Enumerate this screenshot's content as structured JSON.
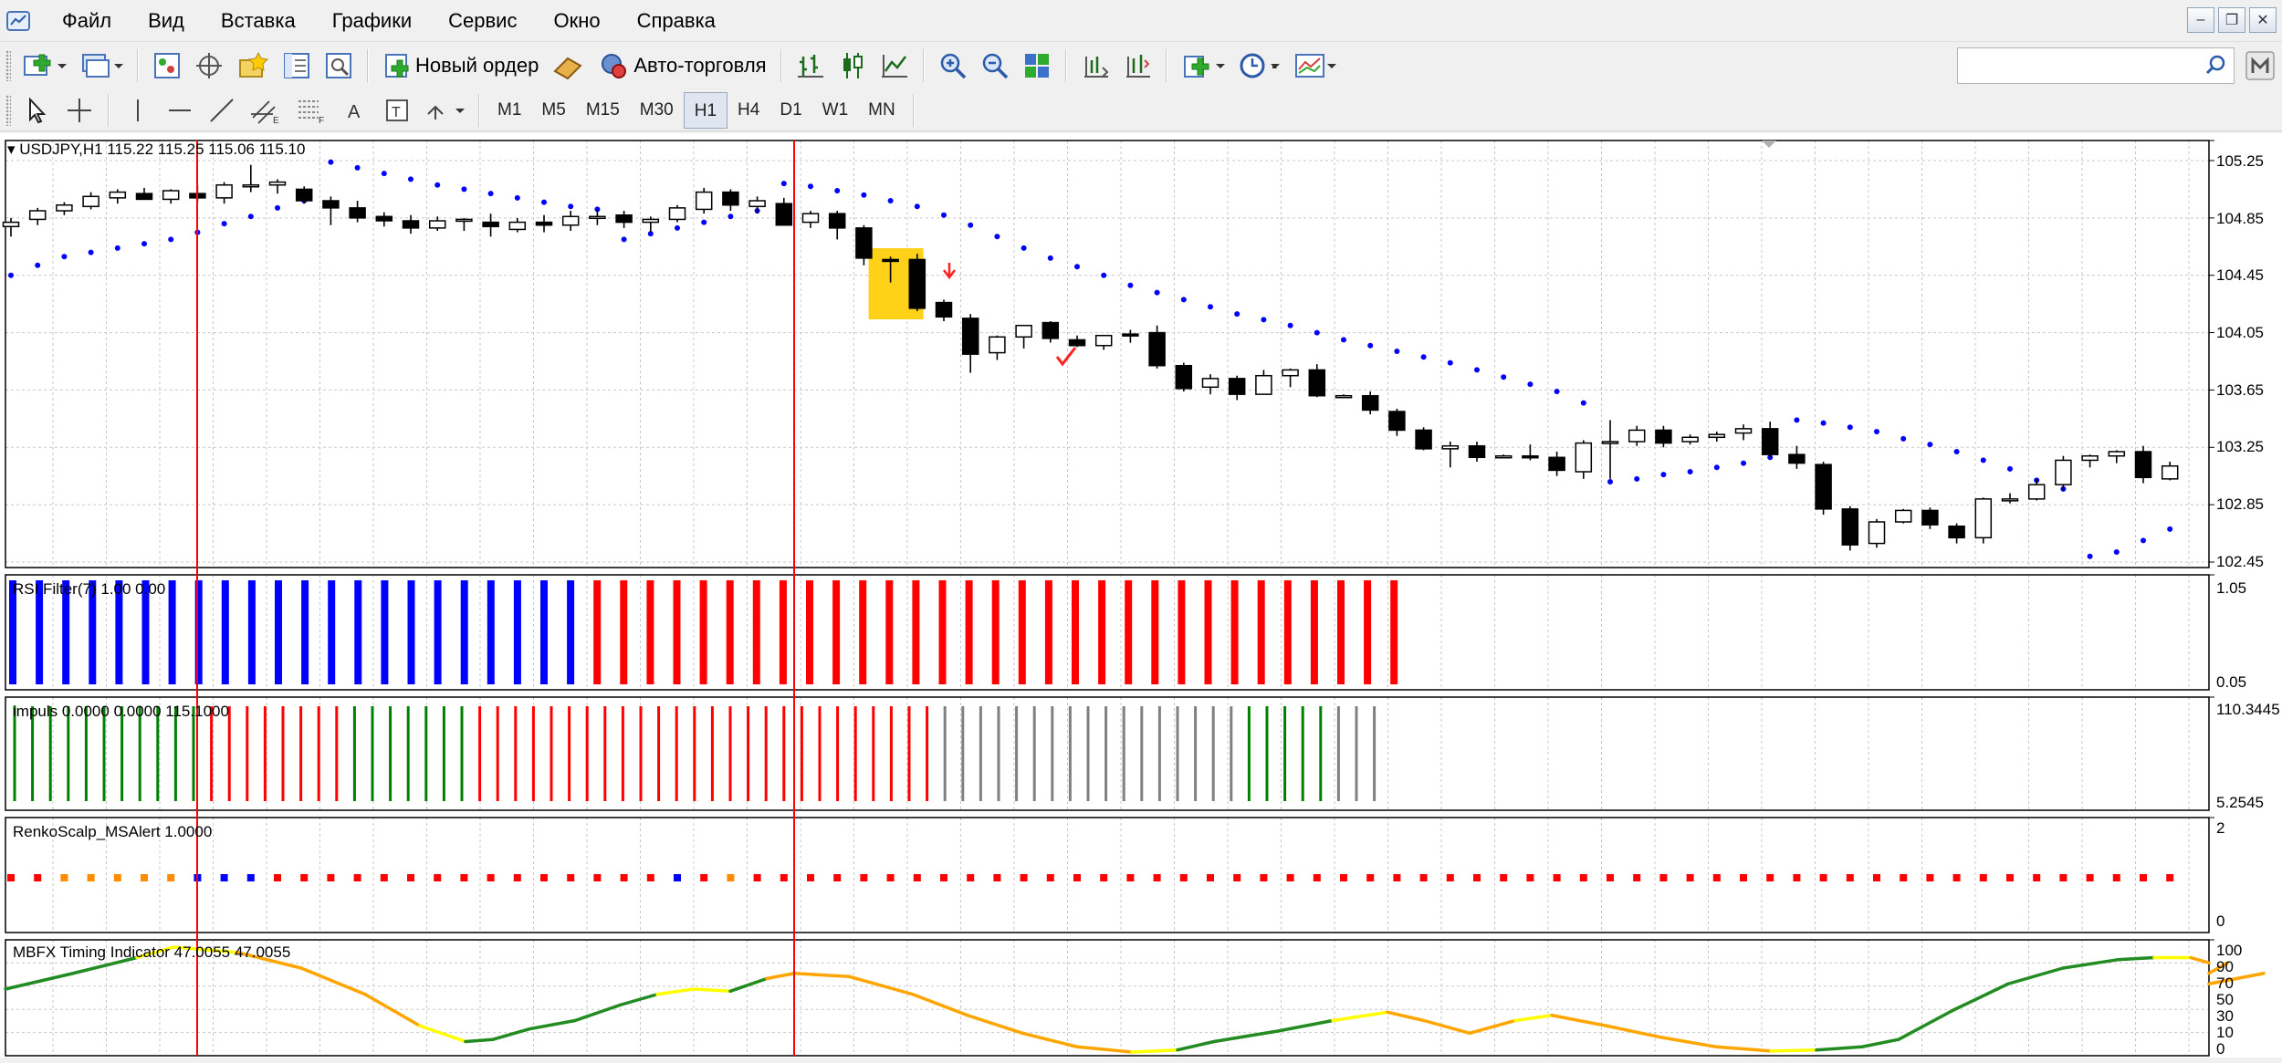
{
  "menu": {
    "items": [
      "Файл",
      "Вид",
      "Вставка",
      "Графики",
      "Сервис",
      "Окно",
      "Справка"
    ]
  },
  "toolbar": {
    "new_order_label": "Новый ордер",
    "auto_trading_label": "Авто-торговля",
    "timeframes": [
      "M1",
      "M5",
      "M15",
      "M30",
      "H1",
      "H4",
      "D1",
      "W1",
      "MN"
    ],
    "active_timeframe": "H1",
    "search_value": ""
  },
  "colors": {
    "bull": "#ffffff",
    "bear": "#000000",
    "sar": "#0000ff",
    "vline": "#ff0000",
    "rsi_up": "#0000ff",
    "rsi_down": "#ff0000",
    "impuls_up": "#008000",
    "impuls_down": "#ff0000",
    "impuls_flat": "#808080",
    "highlight": "#ffcc00",
    "mbfx_green": "#228b22",
    "mbfx_yellow": "#ffff00",
    "mbfx_orange": "#ffa500"
  },
  "chart": {
    "main_label": "USDJPY,H1  115.22 115.25 115.06 115.10",
    "price_ticks": [
      "105.25",
      "104.85",
      "104.45",
      "104.05",
      "103.65",
      "103.25",
      "102.85",
      "102.45"
    ],
    "rsi_label": "RSI Filter(7) 1.00 0.00",
    "rsi_axis": [
      "1.05",
      "0.05"
    ],
    "impuls_label": "impuls 0.0000 0.0000 115.1000",
    "impuls_axis": [
      "110.3445",
      "5.2545"
    ],
    "renko_label": "RenkoScalp_MSAlert 1.0000",
    "renko_axis": [
      "2",
      "0"
    ],
    "mbfx_label": "MBFX Timing Indicator 47.0055 47.0055",
    "mbfx_axis": [
      "100",
      "90",
      "70",
      "50",
      "30",
      "10",
      "0"
    ]
  },
  "chart_data": {
    "type": "candlestick",
    "symbol": "USDJPY",
    "timeframe": "H1",
    "ylim": [
      102.4,
      105.35
    ],
    "candles": [
      [
        104.79,
        104.85,
        104.72,
        104.82
      ],
      [
        104.84,
        104.92,
        104.8,
        104.9
      ],
      [
        104.9,
        104.96,
        104.87,
        104.94
      ],
      [
        104.93,
        105.03,
        104.91,
        105.0
      ],
      [
        104.99,
        105.05,
        104.95,
        105.03
      ],
      [
        105.02,
        105.06,
        104.98,
        104.98
      ],
      [
        104.98,
        105.05,
        104.95,
        105.04
      ],
      [
        105.02,
        105.08,
        104.96,
        104.99
      ],
      [
        104.99,
        105.1,
        104.95,
        105.08
      ],
      [
        105.08,
        105.22,
        105.03,
        105.08
      ],
      [
        105.08,
        105.12,
        105.02,
        105.1
      ],
      [
        105.05,
        105.07,
        104.95,
        104.97
      ],
      [
        104.97,
        105.0,
        104.8,
        104.92
      ],
      [
        104.92,
        104.97,
        104.82,
        104.85
      ],
      [
        104.86,
        104.89,
        104.79,
        104.83
      ],
      [
        104.83,
        104.87,
        104.74,
        104.78
      ],
      [
        104.78,
        104.86,
        104.76,
        104.83
      ],
      [
        104.83,
        104.85,
        104.76,
        104.84
      ],
      [
        104.82,
        104.88,
        104.72,
        104.79
      ],
      [
        104.77,
        104.85,
        104.75,
        104.82
      ],
      [
        104.82,
        104.87,
        104.75,
        104.8
      ],
      [
        104.8,
        104.9,
        104.76,
        104.86
      ],
      [
        104.85,
        104.91,
        104.8,
        104.86
      ],
      [
        104.87,
        104.9,
        104.78,
        104.82
      ],
      [
        104.82,
        104.86,
        104.75,
        104.84
      ],
      [
        104.84,
        104.94,
        104.82,
        104.92
      ],
      [
        104.91,
        105.06,
        104.88,
        105.03
      ],
      [
        105.03,
        105.05,
        104.9,
        104.94
      ],
      [
        104.93,
        105.0,
        104.88,
        104.97
      ],
      [
        104.95,
        104.99,
        104.8,
        104.8
      ],
      [
        104.82,
        104.9,
        104.78,
        104.88
      ],
      [
        104.88,
        104.9,
        104.7,
        104.78
      ],
      [
        104.78,
        104.8,
        104.52,
        104.57
      ],
      [
        104.56,
        104.58,
        104.4,
        104.55
      ],
      [
        104.56,
        104.6,
        104.2,
        104.22
      ],
      [
        104.26,
        104.28,
        104.13,
        104.16
      ],
      [
        104.15,
        104.18,
        103.77,
        103.9
      ],
      [
        103.91,
        104.03,
        103.86,
        104.02
      ],
      [
        104.02,
        104.1,
        103.94,
        104.1
      ],
      [
        104.12,
        104.13,
        103.98,
        104.01
      ],
      [
        104.0,
        104.03,
        103.95,
        103.96
      ],
      [
        103.96,
        104.03,
        103.93,
        104.03
      ],
      [
        104.04,
        104.07,
        103.98,
        104.03
      ],
      [
        104.05,
        104.1,
        103.8,
        103.82
      ],
      [
        103.82,
        103.84,
        103.64,
        103.66
      ],
      [
        103.67,
        103.76,
        103.62,
        103.73
      ],
      [
        103.73,
        103.75,
        103.58,
        103.62
      ],
      [
        103.62,
        103.79,
        103.62,
        103.75
      ],
      [
        103.75,
        103.8,
        103.67,
        103.79
      ],
      [
        103.79,
        103.83,
        103.6,
        103.61
      ],
      [
        103.61,
        103.62,
        103.6,
        103.61
      ],
      [
        103.61,
        103.64,
        103.48,
        103.51
      ],
      [
        103.5,
        103.52,
        103.33,
        103.37
      ],
      [
        103.37,
        103.39,
        103.23,
        103.24
      ],
      [
        103.24,
        103.29,
        103.11,
        103.26
      ],
      [
        103.26,
        103.29,
        103.15,
        103.18
      ],
      [
        103.19,
        103.2,
        103.18,
        103.19
      ],
      [
        103.19,
        103.27,
        103.16,
        103.18
      ],
      [
        103.18,
        103.22,
        103.05,
        103.09
      ],
      [
        103.08,
        103.3,
        103.03,
        103.28
      ],
      [
        103.28,
        103.44,
        103.03,
        103.29
      ],
      [
        103.29,
        103.4,
        103.26,
        103.37
      ],
      [
        103.37,
        103.4,
        103.25,
        103.28
      ],
      [
        103.29,
        103.34,
        103.27,
        103.32
      ],
      [
        103.32,
        103.36,
        103.29,
        103.34
      ],
      [
        103.35,
        103.41,
        103.3,
        103.38
      ],
      [
        103.38,
        103.43,
        103.18,
        103.2
      ],
      [
        103.2,
        103.26,
        103.1,
        103.14
      ],
      [
        103.13,
        103.15,
        102.78,
        102.82
      ],
      [
        102.82,
        102.84,
        102.53,
        102.57
      ],
      [
        102.58,
        102.75,
        102.55,
        102.73
      ],
      [
        102.73,
        102.82,
        102.72,
        102.81
      ],
      [
        102.81,
        102.83,
        102.68,
        102.71
      ],
      [
        102.7,
        102.72,
        102.58,
        102.62
      ],
      [
        102.62,
        102.9,
        102.58,
        102.89
      ],
      [
        102.88,
        102.93,
        102.86,
        102.89
      ],
      [
        102.89,
        103.03,
        102.88,
        102.99
      ],
      [
        102.99,
        103.19,
        102.95,
        103.16
      ],
      [
        103.16,
        103.2,
        103.11,
        103.19
      ],
      [
        103.19,
        103.23,
        103.14,
        103.22
      ],
      [
        103.22,
        103.26,
        103.0,
        103.04
      ],
      [
        103.03,
        103.15,
        103.02,
        103.12
      ]
    ],
    "sar": [
      104.45,
      104.52,
      104.58,
      104.61,
      104.64,
      104.67,
      104.7,
      104.75,
      104.81,
      104.86,
      104.92,
      104.97,
      105.24,
      105.2,
      105.16,
      105.12,
      105.08,
      105.05,
      105.02,
      104.99,
      104.96,
      104.93,
      104.91,
      104.7,
      104.74,
      104.78,
      104.82,
      104.86,
      104.9,
      105.09,
      105.07,
      105.04,
      105.01,
      104.97,
      104.93,
      104.87,
      104.8,
      104.72,
      104.64,
      104.57,
      104.51,
      104.45,
      104.38,
      104.33,
      104.28,
      104.23,
      104.18,
      104.14,
      104.1,
      104.05,
      104.0,
      103.96,
      103.92,
      103.88,
      103.84,
      103.79,
      103.74,
      103.69,
      103.64,
      103.56,
      103.01,
      103.03,
      103.06,
      103.08,
      103.11,
      103.14,
      103.18,
      103.44,
      103.42,
      103.39,
      103.36,
      103.31,
      103.27,
      103.22,
      103.16,
      103.1,
      103.02,
      102.96,
      102.49,
      102.52,
      102.6,
      102.68
    ]
  }
}
